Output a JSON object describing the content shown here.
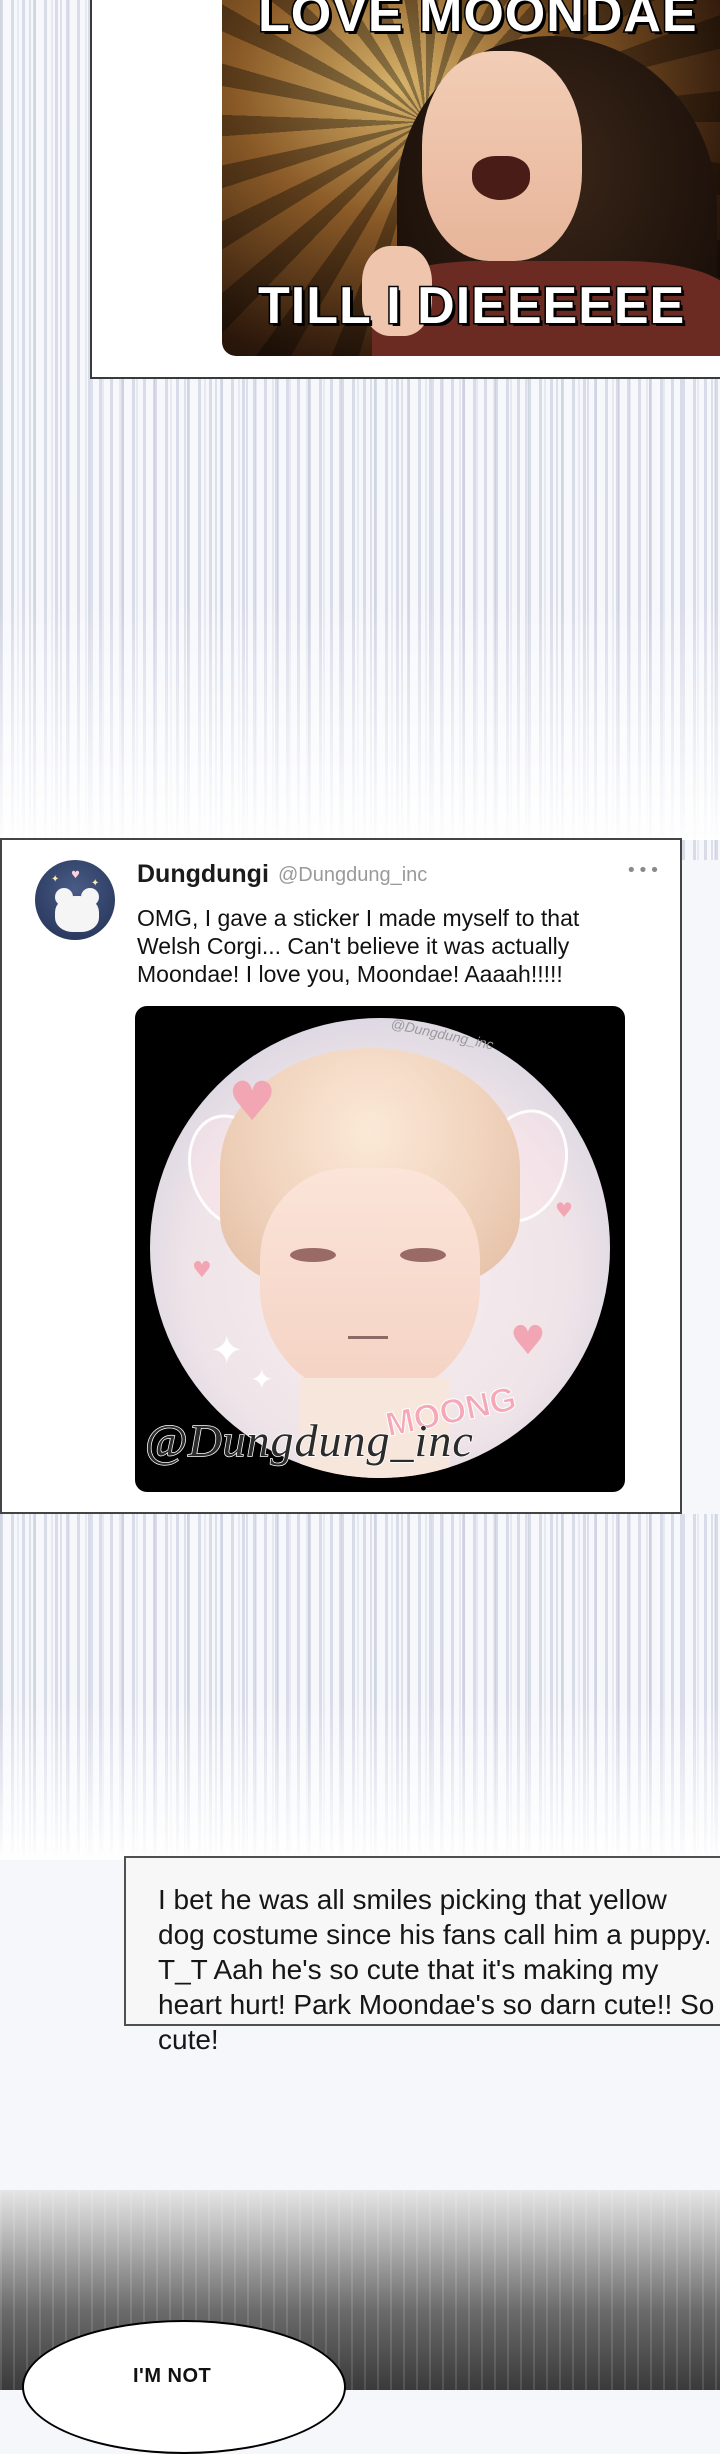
{
  "meme": {
    "top_text": "LOVE MOONDAE",
    "bottom_text": "TILL I DIEEEEEE"
  },
  "tweet": {
    "name": "Dungdungi",
    "handle": "@Dungdung_inc",
    "more": "•••",
    "text": "OMG, I gave a sticker I made myself to that Welsh Corgi... Can't believe it was actually Moondae! I love you, Moondae! Aaaah!!!!!",
    "image": {
      "watermark": "@Dungdung_inc",
      "watermark_small": "@Dungdung_inc",
      "sticker_text": "MOONG"
    }
  },
  "caption": {
    "text": "I bet he was all smiles picking that yellow dog costume since his fans call him a puppy. T_T Aah he's so cute that it's making my heart hurt! Park Moondae's so darn cute!! So cute!"
  },
  "bubble": {
    "text": "I'M NOT"
  }
}
